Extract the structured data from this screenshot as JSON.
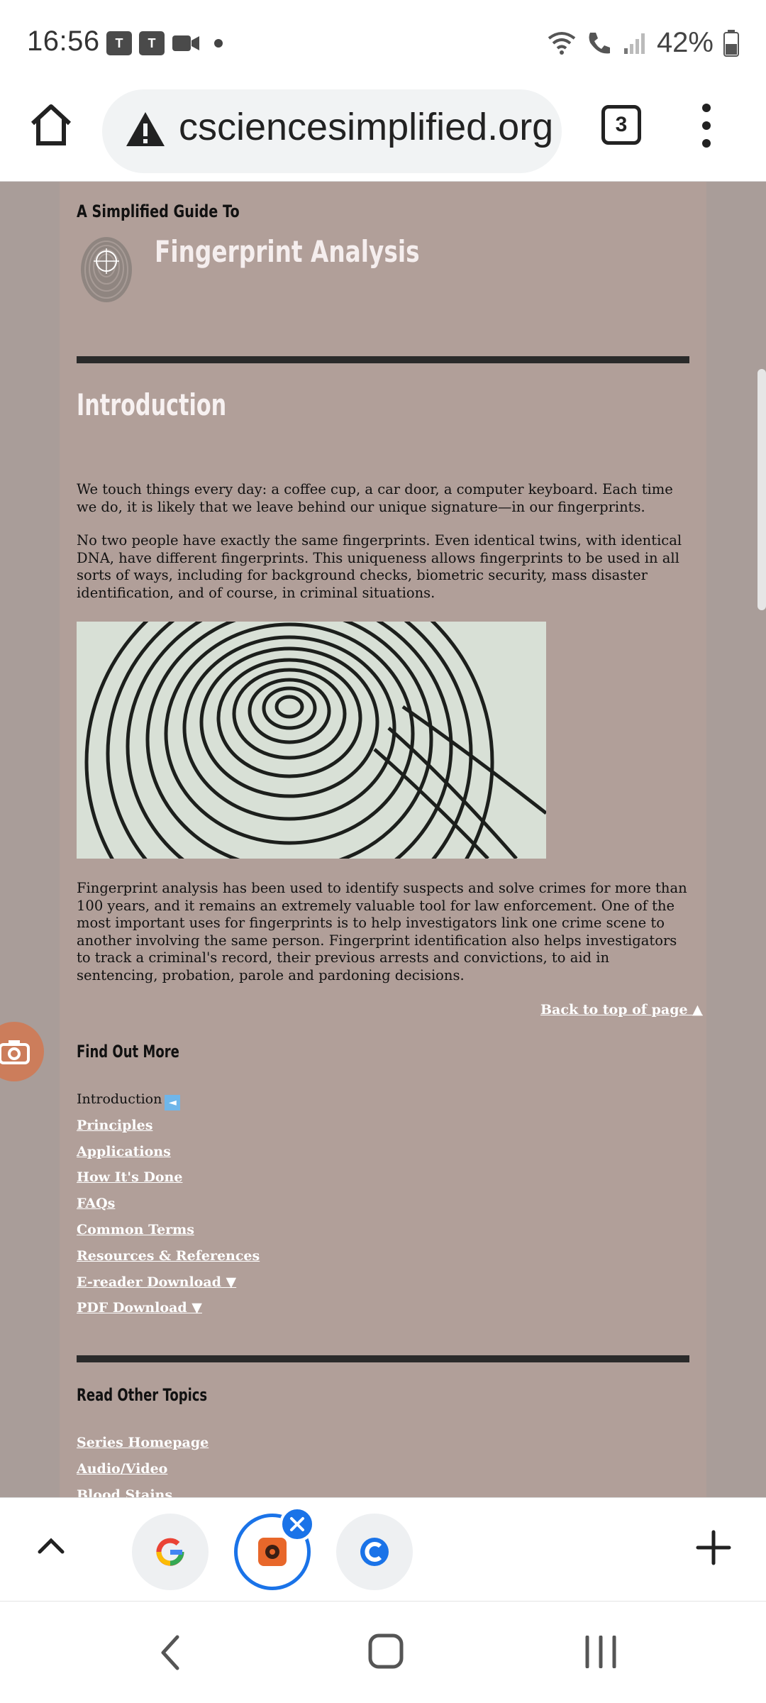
{
  "status_bar": {
    "time": "16:56",
    "app_icons": [
      "teams-icon",
      "teams-icon",
      "video-camera-icon"
    ],
    "battery_percent": "42%"
  },
  "browser": {
    "url": "pcsciencesimplified.org",
    "url_visible": "csciencesimplified.org",
    "tab_count": "3"
  },
  "page": {
    "guide_label": "A Simplified Guide To",
    "title": "Fingerprint Analysis",
    "intro_heading": "Introduction",
    "paragraphs": [
      "We touch things every day: a coffee cup, a car door, a computer keyboard. Each time we do, it is likely that we leave behind our unique signature—in our fingerprints.",
      "No two people have exactly the same fingerprints. Even identical twins, with identical DNA, have different fingerprints. This uniqueness allows fingerprints to be used in all sorts of ways, including for background checks, biometric security, mass disaster identification, and of course, in criminal situations.",
      "Fingerprint analysis has been used to identify suspects and solve crimes for more than 100 years, and it remains an extremely valuable tool for law enforcement. One of the most important uses for fingerprints is to help investigators link one crime scene to another involving the same person. Fingerprint identification also helps investigators to track a criminal's record, their previous arrests and convictions, to aid in sentencing, probation, parole and pardoning decisions."
    ],
    "back_to_top": "Back to top of page ▲",
    "find_out_more_heading": "Find Out More",
    "find_out_more_current": "Introduction",
    "find_out_more_links": [
      "Principles",
      "Applications",
      "How It's Done",
      "FAQs",
      "Common Terms",
      "Resources & References",
      "E-reader Download ▼",
      "PDF Download ▼"
    ],
    "read_other_heading": "Read Other Topics",
    "other_topics": [
      "Series Homepage",
      "Audio/Video",
      "Blood Stains"
    ]
  },
  "colors": {
    "page_bg": "#b19f99",
    "side_bg": "#a99d99",
    "rule": "#2a2a2a",
    "accent_blue": "#1a73e8"
  }
}
